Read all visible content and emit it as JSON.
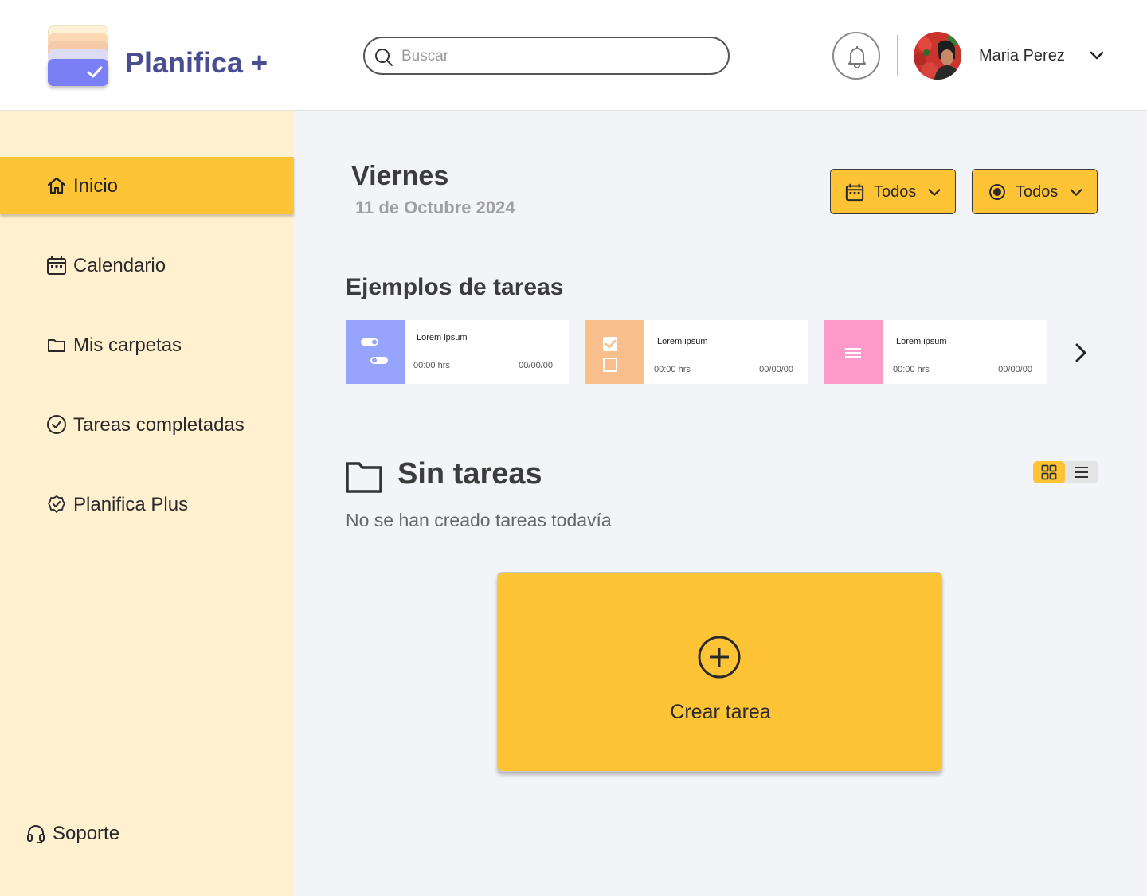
{
  "brand": {
    "name": "Planifica +"
  },
  "search": {
    "placeholder": "Buscar"
  },
  "user": {
    "name": "Maria Perez"
  },
  "sidebar": {
    "items": [
      {
        "label": "Inicio",
        "icon": "home-icon",
        "active": true
      },
      {
        "label": "Calendario",
        "icon": "calendar-icon"
      },
      {
        "label": "Mis carpetas",
        "icon": "folder-icon"
      },
      {
        "label": "Tareas completadas",
        "icon": "check-circle-icon"
      },
      {
        "label": "Planifica Plus",
        "icon": "verified-badge-icon"
      }
    ],
    "support": {
      "label": "Soporte",
      "icon": "headset-icon"
    }
  },
  "main": {
    "day": "Viernes",
    "date": "11 de Octubre 2024",
    "filters": [
      {
        "label": "Todos",
        "icon": "calendar-icon"
      },
      {
        "label": "Todos",
        "icon": "radio-icon"
      }
    ],
    "examples_title": "Ejemplos de tareas",
    "task_examples": [
      {
        "name": "Lorem ipsum",
        "time": "00:00 hrs",
        "date": "00/00/00",
        "icon": "toggle-icon",
        "color": "#97A4FE"
      },
      {
        "name": "Lorem ipsum",
        "time": "00:00 hrs",
        "date": "00/00/00",
        "icon": "checklist-icon",
        "color": "#F8BF8D"
      },
      {
        "name": "Lorem ipsum",
        "time": "00:00 hrs",
        "date": "00/00/00",
        "icon": "menu-lines-icon",
        "color": "#FD9ACA"
      }
    ],
    "empty": {
      "title": "Sin tareas",
      "subtitle": "No se han creado tareas todavía"
    },
    "create": {
      "label": "Crear tarea",
      "icon": "plus-circle-icon"
    }
  },
  "colors": {
    "accent": "#FFC436",
    "sidebar_bg": "#FFF0CF",
    "brand_text": "#4A4E91",
    "page_bg": "#F3F4F8"
  }
}
